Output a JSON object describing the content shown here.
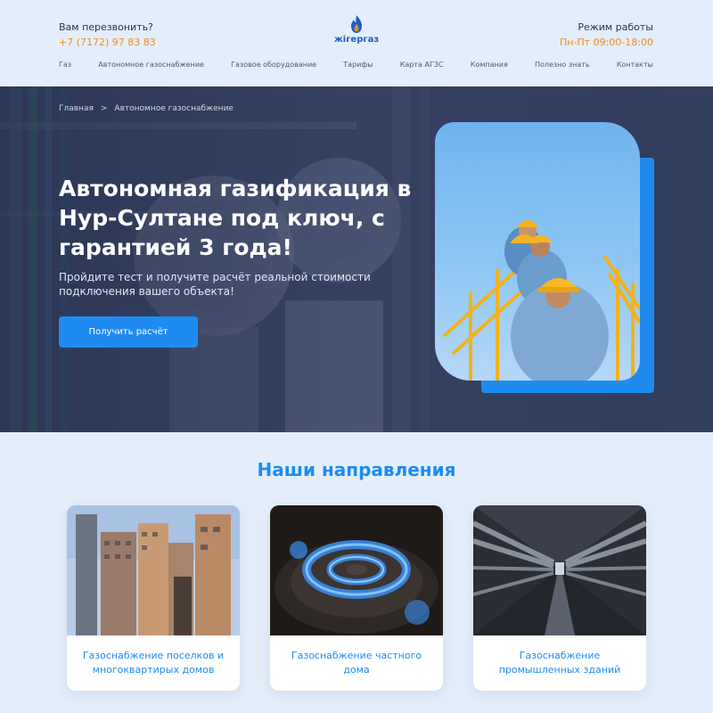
{
  "header": {
    "callback_label": "Вам перезвонить?",
    "phone": "+7 (7172) 97 83 83",
    "logo_text": "жігергаз",
    "hours_label": "Режим работы",
    "hours_value": "Пн-Пт 09:00-18:00"
  },
  "nav": {
    "items": [
      "Газ",
      "Автономное газоснабжение",
      "Газовое оборудование",
      "Тарифы",
      "Карта АГЗС",
      "Компания",
      "Полезно знать",
      "Контакты"
    ]
  },
  "hero": {
    "breadcrumb": [
      "Главная",
      ">",
      "Автономное газоснабжение"
    ],
    "title": "Автономная газификация в Нур-Султане под ключ, с гарантией 3 года!",
    "subtitle": "Пройдите тест и получите расчёт реальной стоимости подключения вашего объекта!",
    "cta_label": "Получить расчёт"
  },
  "directions": {
    "title": "Наши направления",
    "cards": [
      {
        "label": "Газоснабжение поселков и многоквартирых домов"
      },
      {
        "label": "Газоснабжение частного дома"
      },
      {
        "label": "Газоснабжение промышленных зданий"
      }
    ]
  },
  "colors": {
    "accent": "#1f8bf0",
    "phone": "#f08a24",
    "background": "#e4eefb"
  }
}
